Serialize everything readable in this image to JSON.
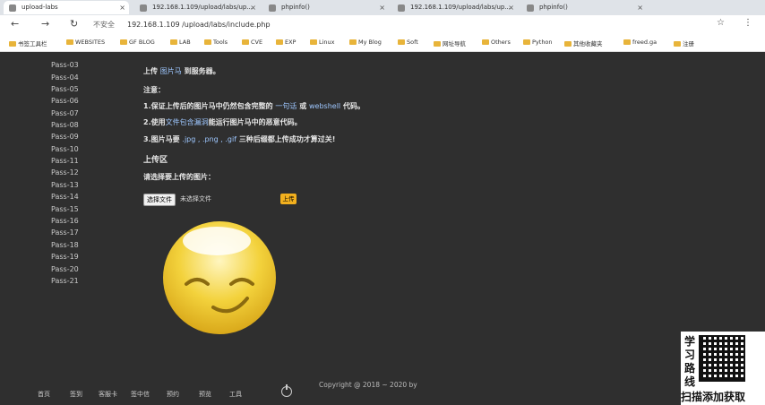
{
  "tabs": [
    {
      "label": "upload-labs",
      "active": true
    },
    {
      "label": "192.168.1.109/upload/labs/up...",
      "active": false
    },
    {
      "label": "phpinfo()",
      "active": false
    },
    {
      "label": "192.168.1.109/upload/labs/up...",
      "active": false
    },
    {
      "label": "phpinfo()",
      "active": false
    }
  ],
  "address": {
    "secure": "不安全",
    "url": "192.168.1.109 /upload/labs/include.php"
  },
  "bookmarks": [
    "书签工具栏",
    "WEBSITES",
    "GF BLOG",
    "LAB",
    "Tools",
    "CVE",
    "EXP",
    "Linux",
    "My Blog",
    "Soft",
    "网址导航",
    "Others",
    "Python",
    "其他收藏夹",
    "freed.ga",
    "注册"
  ],
  "sidebar": {
    "items": [
      "Pass-03",
      "Pass-04",
      "Pass-05",
      "Pass-06",
      "Pass-07",
      "Pass-08",
      "Pass-09",
      "Pass-10",
      "Pass-11",
      "Pass-12",
      "Pass-13",
      "Pass-14",
      "Pass-15",
      "Pass-16",
      "Pass-17",
      "Pass-18",
      "Pass-19",
      "Pass-20",
      "Pass-21"
    ]
  },
  "task": {
    "intro_a": "上传",
    "intro_hl": "图片马",
    "intro_b": "到服务器。",
    "note": "注意：",
    "n1a": "1.保证上传后的图片马中仍然包含完整的",
    "n1hl": "一句话",
    "n1b": "或",
    "n1hl2": "webshell",
    "n1c": "代码。",
    "n2a": "2.使用",
    "n2hl": "文件包含漏洞",
    "n2b": "能运行图片马中的恶意代码。",
    "n3a": "3.图片马要",
    "n3hl": ".jpg , .png , .gif",
    "n3b": "三种后缀都上传成功才算过关!",
    "section": "上传区",
    "choose_label": "请选择要上传的图片：",
    "file_button": "选择文件",
    "file_status": "未选择文件",
    "upload_button": "上传"
  },
  "footer": "Copyright @ 2018 ~ 2020 by",
  "taskbar": [
    "首页",
    "签到",
    "客服卡",
    "签中信",
    "预约",
    "预览",
    "工具"
  ],
  "overlay": {
    "side_text": [
      "学",
      "习",
      "路",
      "线"
    ],
    "bottom_text": "扫描添加获取"
  },
  "colors": {
    "bg": "#2f2f2f",
    "upload_btn": "#f2b01e",
    "folder": "#e8b43a"
  }
}
